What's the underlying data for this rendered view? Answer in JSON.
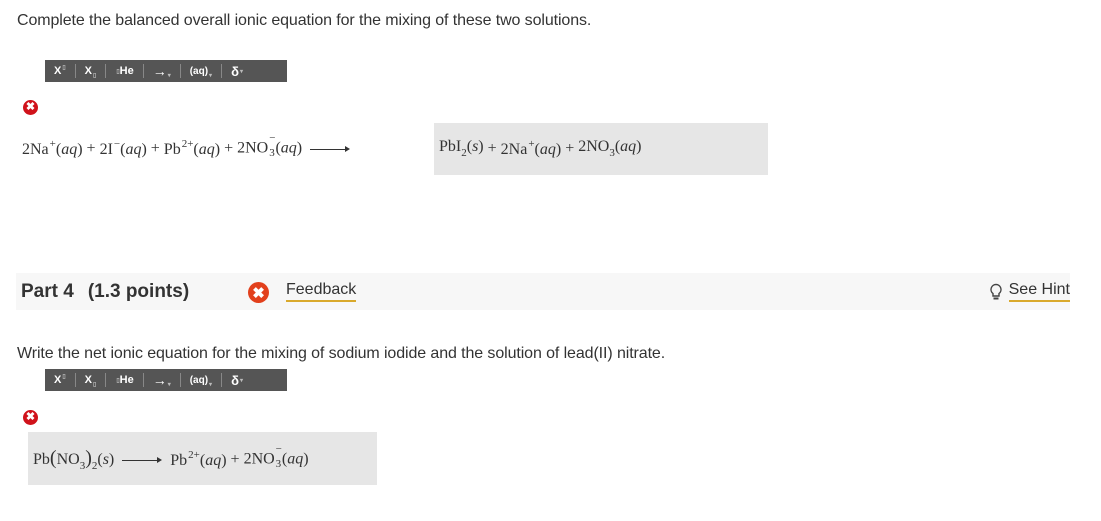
{
  "part3": {
    "prompt": "Complete the balanced overall ionic equation for the mixing of these two solutions.",
    "toolbar": {
      "superscript": "X",
      "subscript": "X",
      "element": "He",
      "arrow": "→",
      "state": "(aq)",
      "delta": "δ"
    },
    "status_icon": "incorrect-icon",
    "reactants": [
      {
        "coef": "2",
        "formula": "Na",
        "charge": "+",
        "state": "aq"
      },
      {
        "coef": "2",
        "formula": "I",
        "charge": "−",
        "state": "aq"
      },
      {
        "coef": "",
        "formula": "Pb",
        "charge": "2+",
        "state": "aq"
      },
      {
        "coef": "2",
        "formula": "NO",
        "sub": "3",
        "charge": "−",
        "state": "aq"
      }
    ],
    "answer": {
      "p1": {
        "formula": "PbI",
        "sub": "2",
        "state": "s"
      },
      "p2": {
        "coef": "2",
        "formula": "Na",
        "charge": "+",
        "state": "aq"
      },
      "p3": {
        "coef": "2",
        "formula": "NO",
        "sub": "3",
        "state": "aq"
      }
    },
    "plus": "+"
  },
  "part4": {
    "title": "Part 4",
    "points": "(1.3 points)",
    "feedback_label": "Feedback",
    "hint_label": "See Hint",
    "prompt": "Write the net ionic equation for the mixing of sodium iodide and the solution of lead(II) nitrate.",
    "toolbar": {
      "superscript": "X",
      "subscript": "X",
      "element": "He",
      "arrow": "→",
      "state": "(aq)",
      "delta": "δ"
    },
    "status_icon": "incorrect-icon",
    "answer": {
      "reactant": {
        "formula": "Pb",
        "group": "NO",
        "group_sub": "3",
        "group_count": "2",
        "state": "s"
      },
      "p1": {
        "formula": "Pb",
        "charge": "2+",
        "state": "aq"
      },
      "p2": {
        "coef": "2",
        "formula": "NO",
        "sub": "3",
        "charge": "−",
        "state": "aq"
      }
    },
    "plus": "+"
  },
  "colors": {
    "error_red": "#d0121b",
    "feedback_red": "#e2401c",
    "underline_gold": "#d9a92c",
    "toolbar_bg": "#555555",
    "answer_bg": "#e6e6e6"
  }
}
